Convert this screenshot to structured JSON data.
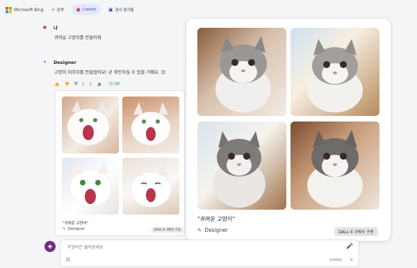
{
  "topbar": {
    "brand": "Microsoft Bing",
    "tabs": [
      {
        "label": "검색",
        "icon": "search-icon"
      },
      {
        "label": "Copilot",
        "icon": "copilot-icon"
      },
      {
        "label": "검사 참가들",
        "icon": "notebook-icon"
      }
    ]
  },
  "user_message": {
    "sender": "나",
    "text": "귀여운 고양이를 만들어줘"
  },
  "bot_message": {
    "sender": "Designer",
    "text": "고양이 이미지를 만들었어요! 곧 확인하실 수 있을 거예요. 😊",
    "tools_badge": "1 / 30"
  },
  "small_card": {
    "caption": "\"귀여운 고양이\"",
    "designer": "Designer",
    "badge": "DALL·E 3에서 구동"
  },
  "big_card": {
    "caption": "\"귀여운 고양이\"",
    "designer": "Designer",
    "badge": "DALL·E 3에서 구동"
  },
  "compose": {
    "placeholder": "무엇이든 물어보세요",
    "counter": "0/4000"
  },
  "colors": {
    "accent": "#2a4fb8",
    "avatar": "#6b2f7f",
    "designer": "#7b4fd8"
  }
}
